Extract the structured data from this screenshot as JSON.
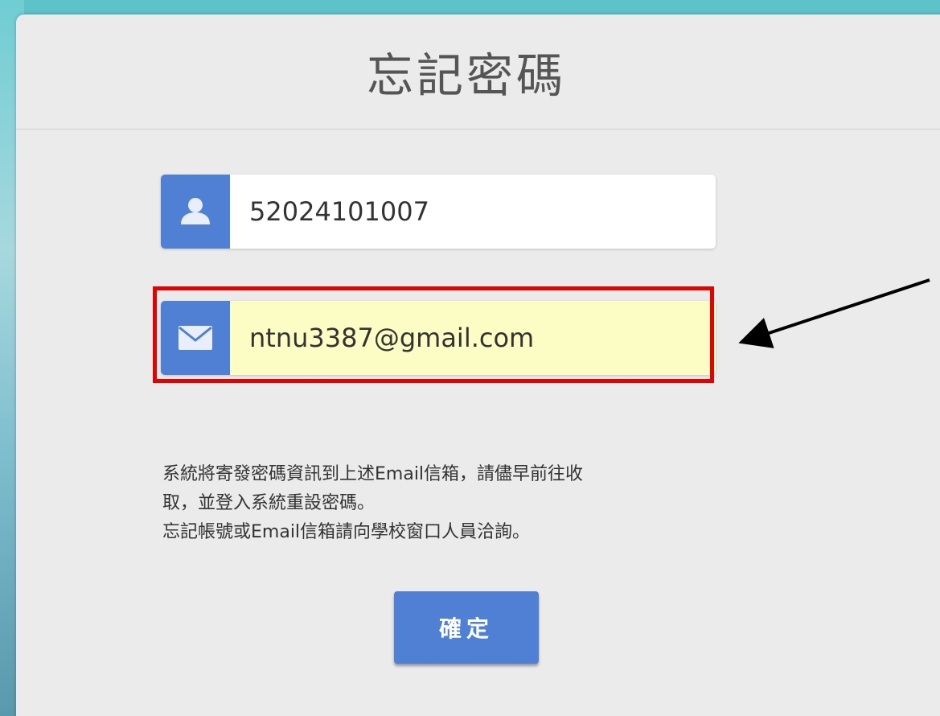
{
  "page": {
    "title": "忘記密碼"
  },
  "form": {
    "account": {
      "icon": "user-icon",
      "value": "52024101007"
    },
    "email": {
      "icon": "envelope-icon",
      "value": "ntnu3387@gmail.com",
      "autofill_color": "#fcfdc4"
    },
    "notice_lines": [
      "系統將寄發密碼資訊到上述Email信箱，請儘早前往收",
      "取，並登入系統重設密碼。",
      "忘記帳號或Email信箱請向學校窗口人員洽詢。"
    ],
    "confirm_label": "確定"
  },
  "annotation": {
    "highlight_color": "#e60000",
    "arrow_color": "#000000"
  },
  "colors": {
    "accent": "#4f80d4",
    "panel": "#ebebeb"
  }
}
